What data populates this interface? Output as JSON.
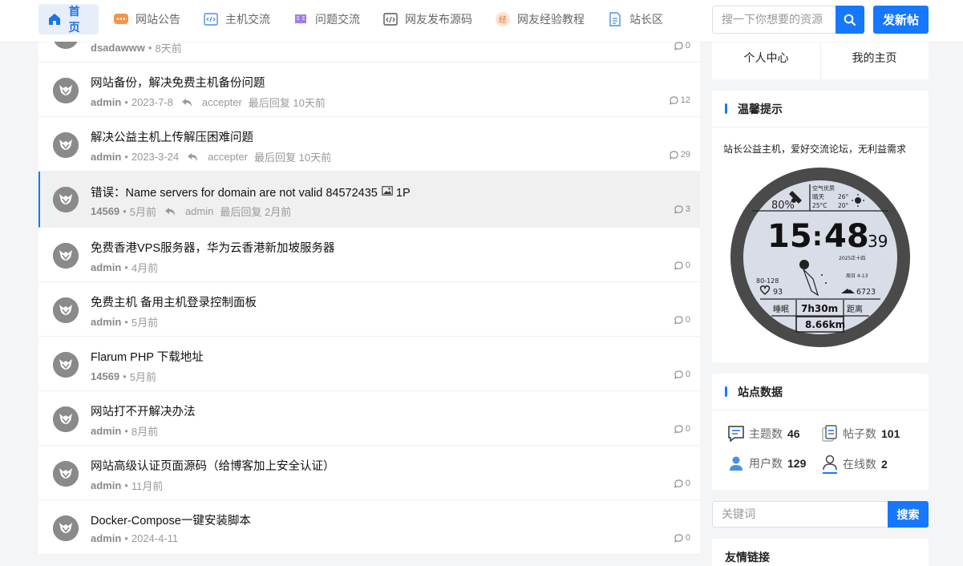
{
  "nav": {
    "items": [
      {
        "label": "首页",
        "icon": "home-icon",
        "active": true
      },
      {
        "label": "网站公告",
        "icon": "announcement-icon"
      },
      {
        "label": "主机交流",
        "icon": "code-icon"
      },
      {
        "label": "问题交流",
        "icon": "book-icon"
      },
      {
        "label": "网友发布源码",
        "icon": "source-code-icon"
      },
      {
        "label": "网友经验教程",
        "icon": "tutorial-icon"
      },
      {
        "label": "站长区",
        "icon": "document-icon"
      }
    ],
    "search_placeholder": "搜一下你想要的资源",
    "post_label": "发新帖"
  },
  "posts": [
    {
      "title": "",
      "author": "dsadawww",
      "time": "8天前",
      "replier": "",
      "reply_time": "",
      "count": "0"
    },
    {
      "title": "网站备份，解决免费主机备份问题",
      "author": "admin",
      "time": "2023-7-8",
      "replier": "accepter",
      "reply_time": "最后回复 10天前",
      "count": "12"
    },
    {
      "title": "解决公益主机上传解压困难问题",
      "author": "admin",
      "time": "2023-3-24",
      "replier": "accepter",
      "reply_time": "最后回复 10天前",
      "count": "29"
    },
    {
      "title": "错误：Name servers for domain are not valid 84572435",
      "title_suffix": "1P",
      "author": "14569",
      "time": "5月前",
      "replier": "admin",
      "reply_time": "最后回复 2月前",
      "count": "3"
    },
    {
      "title": "免费香港VPS服务器，华为云香港新加坡服务器",
      "author": "admin",
      "time": "4月前",
      "count": "0"
    },
    {
      "title": "免费主机 备用主机登录控制面板",
      "author": "admin",
      "time": "5月前",
      "count": "0"
    },
    {
      "title": "Flarum PHP 下载地址",
      "author": "14569",
      "time": "5月前",
      "count": "0"
    },
    {
      "title": "网站打不开解决办法",
      "author": "admin",
      "time": "8月前",
      "count": "0"
    },
    {
      "title": "网站高级认证页面源码（给博客加上安全认证）",
      "author": "admin",
      "time": "11月前",
      "count": "0"
    },
    {
      "title": "Docker-Compose一键安装脚本",
      "author": "admin",
      "time": "2024-4-11",
      "count": "0"
    }
  ],
  "sidebar": {
    "user": {
      "center": "个人中心",
      "home": "我的主页"
    },
    "tip": {
      "title": "温馨提示",
      "text": "站长公益主机，爱好交流论坛，无利益需求",
      "watch": {
        "battery": "80%",
        "air": "空气优质",
        "weather": "晴天",
        "temp_hi": "26°",
        "temp_cur": "25°C",
        "temp_lo": "20°",
        "hour": "15",
        "minute": "48",
        "second": "39",
        "lunar": "2025正十四",
        "week_date": "周日 4-13",
        "hr_range": "80-128",
        "heart": "93",
        "steps": "6723",
        "sleep_label": "睡眠",
        "sleep": "7h30m",
        "distance_label": "距离",
        "distance": "8.66km"
      }
    },
    "stats": {
      "title": "站点数据",
      "topics_label": "主题数",
      "topics": "46",
      "posts_label": "帖子数",
      "posts": "101",
      "users_label": "用户数",
      "users": "129",
      "online_label": "在线数",
      "online": "2"
    },
    "keyword": {
      "placeholder": "关键词",
      "button": "搜索"
    },
    "links": {
      "title": "友情链接"
    }
  },
  "colors": {
    "accent": "#1677ff",
    "highlight_row": "#f0f0f0"
  }
}
